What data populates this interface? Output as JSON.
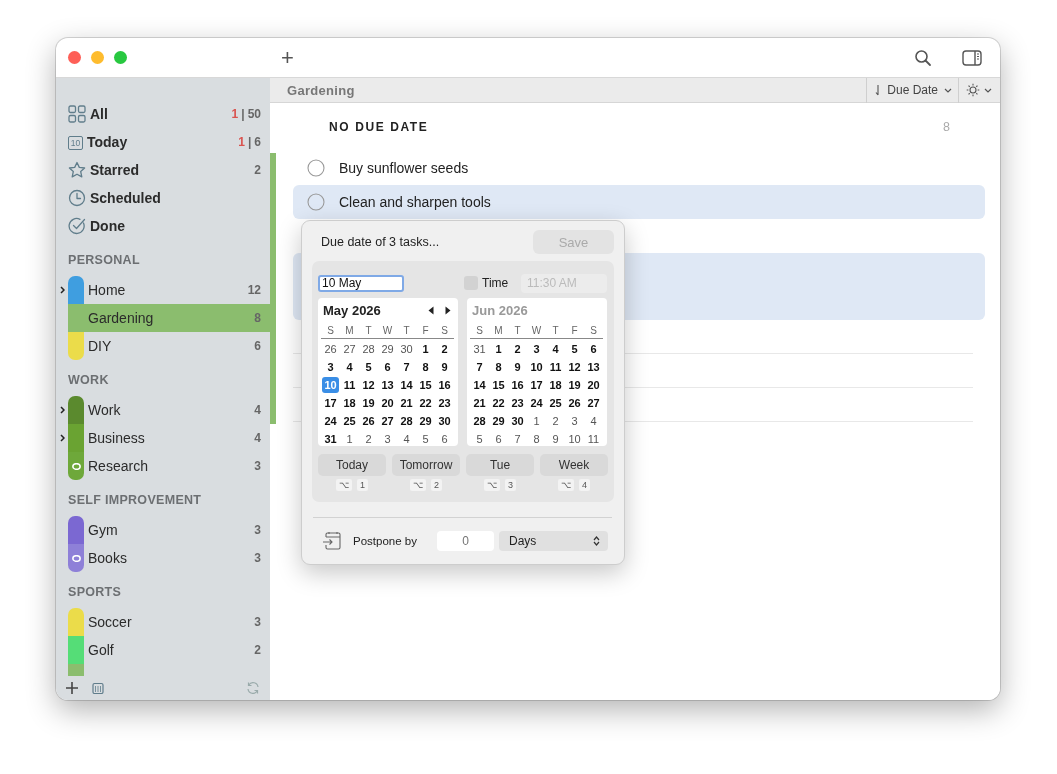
{
  "window": {
    "add_label": "+"
  },
  "sidebar": {
    "smart_lists": [
      {
        "kind": "all",
        "label": "All",
        "overdue": "1",
        "separator": "|",
        "count": "50",
        "selected": false
      },
      {
        "kind": "today",
        "label": "Today",
        "badge": "10",
        "overdue": "1",
        "separator": "|",
        "count": "6",
        "selected": false
      },
      {
        "kind": "starred",
        "label": "Starred",
        "count": "2",
        "selected": false
      },
      {
        "kind": "scheduled",
        "label": "Scheduled",
        "selected": false
      },
      {
        "kind": "done",
        "label": "Done",
        "selected": false
      }
    ],
    "groups": [
      {
        "title": "PERSONAL",
        "lists": [
          {
            "kind": "plain",
            "label": "Home",
            "count": "12",
            "color": "#3f9ee0",
            "expanded": false,
            "selected": false
          },
          {
            "kind": "plain",
            "label": "Gardening",
            "count": "8",
            "color": "#8bbd6e",
            "selected": true
          },
          {
            "kind": "plain",
            "label": "DIY",
            "count": "6",
            "color": "#ebdc4a",
            "selected": false
          }
        ]
      },
      {
        "title": "WORK",
        "lists": [
          {
            "kind": "plain",
            "label": "Work",
            "count": "4",
            "color": "#5b8a2e",
            "expanded": false,
            "selected": false
          },
          {
            "kind": "plain",
            "label": "Business",
            "count": "4",
            "color": "#6aa332",
            "expanded": false,
            "selected": false
          },
          {
            "kind": "ring",
            "label": "Research",
            "count": "3",
            "color": "#6ea83a",
            "selected": false
          }
        ]
      },
      {
        "title": "SELF IMPROVEMENT",
        "lists": [
          {
            "kind": "plain",
            "label": "Gym",
            "count": "3",
            "color": "#7b68d2",
            "selected": false
          },
          {
            "kind": "ring",
            "label": "Books",
            "count": "3",
            "color": "#8e80d8",
            "selected": false
          }
        ]
      },
      {
        "title": "SPORTS",
        "lists": [
          {
            "kind": "plain",
            "label": "Soccer",
            "count": "3",
            "color": "#ebdc4a",
            "selected": false
          },
          {
            "kind": "plain",
            "label": "Golf",
            "count": "2",
            "color": "#55dd77",
            "selected": false
          },
          {
            "kind": "plain",
            "color": "#8bbd6e",
            "selected": false
          }
        ]
      }
    ]
  },
  "toolbar": {
    "list_title": "Gardening",
    "sort": "Due Date"
  },
  "section": {
    "title": "NO DUE DATE",
    "count": "8",
    "tasks": [
      {
        "title": "Buy sunflower seeds",
        "done": false,
        "selected": false
      },
      {
        "title": "Clean and sharpen tools",
        "done": false,
        "selected": true
      }
    ]
  },
  "popover": {
    "title": "Due date of 3 tasks...",
    "save": {
      "label": "Save",
      "disabled": true
    },
    "date_field": {
      "value": "10 May"
    },
    "time": {
      "label": "Time",
      "checked": false,
      "value": "11:30 AM",
      "disabled": true
    },
    "months": [
      {
        "title": "May 2026",
        "focused": true,
        "weekdays": [
          "S",
          "M",
          "T",
          "W",
          "T",
          "F",
          "S"
        ],
        "weeks": [
          [
            {
              "t": "26",
              "in_month": false,
              "selected": false
            },
            {
              "t": "27",
              "in_month": false,
              "selected": false
            },
            {
              "t": "28",
              "in_month": false,
              "selected": false
            },
            {
              "t": "29",
              "in_month": false,
              "selected": false
            },
            {
              "t": "30",
              "in_month": false,
              "selected": false
            },
            {
              "t": "1",
              "in_month": true,
              "selected": false
            },
            {
              "t": "2",
              "in_month": true,
              "selected": false
            }
          ],
          [
            {
              "t": "3",
              "in_month": true,
              "selected": false
            },
            {
              "t": "4",
              "in_month": true,
              "selected": false
            },
            {
              "t": "5",
              "in_month": true,
              "selected": false
            },
            {
              "t": "6",
              "in_month": true,
              "selected": false
            },
            {
              "t": "7",
              "in_month": true,
              "selected": false
            },
            {
              "t": "8",
              "in_month": true,
              "selected": false
            },
            {
              "t": "9",
              "in_month": true,
              "selected": false
            }
          ],
          [
            {
              "t": "10",
              "in_month": true,
              "selected": true
            },
            {
              "t": "11",
              "in_month": true,
              "selected": false
            },
            {
              "t": "12",
              "in_month": true,
              "selected": false
            },
            {
              "t": "13",
              "in_month": true,
              "selected": false
            },
            {
              "t": "14",
              "in_month": true,
              "selected": false
            },
            {
              "t": "15",
              "in_month": true,
              "selected": false
            },
            {
              "t": "16",
              "in_month": true,
              "selected": false
            }
          ],
          [
            {
              "t": "17",
              "in_month": true,
              "selected": false
            },
            {
              "t": "18",
              "in_month": true,
              "selected": false
            },
            {
              "t": "19",
              "in_month": true,
              "selected": false
            },
            {
              "t": "20",
              "in_month": true,
              "selected": false
            },
            {
              "t": "21",
              "in_month": true,
              "selected": false
            },
            {
              "t": "22",
              "in_month": true,
              "selected": false
            },
            {
              "t": "23",
              "in_month": true,
              "selected": false
            }
          ],
          [
            {
              "t": "24",
              "in_month": true,
              "selected": false
            },
            {
              "t": "25",
              "in_month": true,
              "selected": false
            },
            {
              "t": "26",
              "in_month": true,
              "selected": false
            },
            {
              "t": "27",
              "in_month": true,
              "selected": false
            },
            {
              "t": "28",
              "in_month": true,
              "selected": false
            },
            {
              "t": "29",
              "in_month": true,
              "selected": false
            },
            {
              "t": "30",
              "in_month": true,
              "selected": false
            }
          ],
          [
            {
              "t": "31",
              "in_month": true,
              "selected": false
            },
            {
              "t": "1",
              "in_month": false,
              "selected": false
            },
            {
              "t": "2",
              "in_month": false,
              "selected": false
            },
            {
              "t": "3",
              "in_month": false,
              "selected": false
            },
            {
              "t": "4",
              "in_month": false,
              "selected": false
            },
            {
              "t": "5",
              "in_month": false,
              "selected": false
            },
            {
              "t": "6",
              "in_month": false,
              "selected": false
            }
          ]
        ]
      },
      {
        "title": "Jun 2026",
        "focused": false,
        "weekdays": [
          "S",
          "M",
          "T",
          "W",
          "T",
          "F",
          "S"
        ],
        "weeks": [
          [
            {
              "t": "31",
              "in_month": false,
              "selected": false
            },
            {
              "t": "1",
              "in_month": true,
              "selected": false
            },
            {
              "t": "2",
              "in_month": true,
              "selected": false
            },
            {
              "t": "3",
              "in_month": true,
              "selected": false
            },
            {
              "t": "4",
              "in_month": true,
              "selected": false
            },
            {
              "t": "5",
              "in_month": true,
              "selected": false
            },
            {
              "t": "6",
              "in_month": true,
              "selected": false
            }
          ],
          [
            {
              "t": "7",
              "in_month": true,
              "selected": false
            },
            {
              "t": "8",
              "in_month": true,
              "selected": false
            },
            {
              "t": "9",
              "in_month": true,
              "selected": false
            },
            {
              "t": "10",
              "in_month": true,
              "selected": false
            },
            {
              "t": "11",
              "in_month": true,
              "selected": false
            },
            {
              "t": "12",
              "in_month": true,
              "selected": false
            },
            {
              "t": "13",
              "in_month": true,
              "selected": false
            }
          ],
          [
            {
              "t": "14",
              "in_month": true,
              "selected": false
            },
            {
              "t": "15",
              "in_month": true,
              "selected": false
            },
            {
              "t": "16",
              "in_month": true,
              "selected": false
            },
            {
              "t": "17",
              "in_month": true,
              "selected": false
            },
            {
              "t": "18",
              "in_month": true,
              "selected": false
            },
            {
              "t": "19",
              "in_month": true,
              "selected": false
            },
            {
              "t": "20",
              "in_month": true,
              "selected": false
            }
          ],
          [
            {
              "t": "21",
              "in_month": true,
              "selected": false
            },
            {
              "t": "22",
              "in_month": true,
              "selected": false
            },
            {
              "t": "23",
              "in_month": true,
              "selected": false
            },
            {
              "t": "24",
              "in_month": true,
              "selected": false
            },
            {
              "t": "25",
              "in_month": true,
              "selected": false
            },
            {
              "t": "26",
              "in_month": true,
              "selected": false
            },
            {
              "t": "27",
              "in_month": true,
              "selected": false
            }
          ],
          [
            {
              "t": "28",
              "in_month": true,
              "selected": false
            },
            {
              "t": "29",
              "in_month": true,
              "selected": false
            },
            {
              "t": "30",
              "in_month": true,
              "selected": false
            },
            {
              "t": "1",
              "in_month": false,
              "selected": false
            },
            {
              "t": "2",
              "in_month": false,
              "selected": false
            },
            {
              "t": "3",
              "in_month": false,
              "selected": false
            },
            {
              "t": "4",
              "in_month": false,
              "selected": false
            }
          ],
          [
            {
              "t": "5",
              "in_month": false,
              "selected": false
            },
            {
              "t": "6",
              "in_month": false,
              "selected": false
            },
            {
              "t": "7",
              "in_month": false,
              "selected": false
            },
            {
              "t": "8",
              "in_month": false,
              "selected": false
            },
            {
              "t": "9",
              "in_month": false,
              "selected": false
            },
            {
              "t": "10",
              "in_month": false,
              "selected": false
            },
            {
              "t": "11",
              "in_month": false,
              "selected": false
            }
          ]
        ]
      }
    ],
    "quick": [
      {
        "label": "Today",
        "shortcut": [
          "⌥",
          "1"
        ]
      },
      {
        "label": "Tomorrow",
        "shortcut": [
          "⌥",
          "2"
        ]
      },
      {
        "label": "Tue",
        "shortcut": [
          "⌥",
          "3"
        ]
      },
      {
        "label": "Week",
        "shortcut": [
          "⌥",
          "4"
        ]
      }
    ],
    "postpone": {
      "label": "Postpone by",
      "placeholder": "0",
      "unit": "Days"
    }
  }
}
